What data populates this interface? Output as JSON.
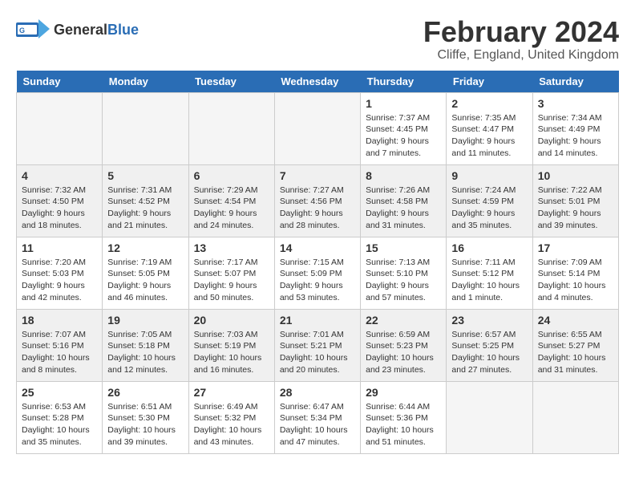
{
  "header": {
    "logo_general": "General",
    "logo_blue": "Blue",
    "title": "February 2024",
    "subtitle": "Cliffe, England, United Kingdom"
  },
  "weekdays": [
    "Sunday",
    "Monday",
    "Tuesday",
    "Wednesday",
    "Thursday",
    "Friday",
    "Saturday"
  ],
  "weeks": [
    [
      {
        "day": "",
        "info": ""
      },
      {
        "day": "",
        "info": ""
      },
      {
        "day": "",
        "info": ""
      },
      {
        "day": "",
        "info": ""
      },
      {
        "day": "1",
        "info": "Sunrise: 7:37 AM\nSunset: 4:45 PM\nDaylight: 9 hours\nand 7 minutes."
      },
      {
        "day": "2",
        "info": "Sunrise: 7:35 AM\nSunset: 4:47 PM\nDaylight: 9 hours\nand 11 minutes."
      },
      {
        "day": "3",
        "info": "Sunrise: 7:34 AM\nSunset: 4:49 PM\nDaylight: 9 hours\nand 14 minutes."
      }
    ],
    [
      {
        "day": "4",
        "info": "Sunrise: 7:32 AM\nSunset: 4:50 PM\nDaylight: 9 hours\nand 18 minutes."
      },
      {
        "day": "5",
        "info": "Sunrise: 7:31 AM\nSunset: 4:52 PM\nDaylight: 9 hours\nand 21 minutes."
      },
      {
        "day": "6",
        "info": "Sunrise: 7:29 AM\nSunset: 4:54 PM\nDaylight: 9 hours\nand 24 minutes."
      },
      {
        "day": "7",
        "info": "Sunrise: 7:27 AM\nSunset: 4:56 PM\nDaylight: 9 hours\nand 28 minutes."
      },
      {
        "day": "8",
        "info": "Sunrise: 7:26 AM\nSunset: 4:58 PM\nDaylight: 9 hours\nand 31 minutes."
      },
      {
        "day": "9",
        "info": "Sunrise: 7:24 AM\nSunset: 4:59 PM\nDaylight: 9 hours\nand 35 minutes."
      },
      {
        "day": "10",
        "info": "Sunrise: 7:22 AM\nSunset: 5:01 PM\nDaylight: 9 hours\nand 39 minutes."
      }
    ],
    [
      {
        "day": "11",
        "info": "Sunrise: 7:20 AM\nSunset: 5:03 PM\nDaylight: 9 hours\nand 42 minutes."
      },
      {
        "day": "12",
        "info": "Sunrise: 7:19 AM\nSunset: 5:05 PM\nDaylight: 9 hours\nand 46 minutes."
      },
      {
        "day": "13",
        "info": "Sunrise: 7:17 AM\nSunset: 5:07 PM\nDaylight: 9 hours\nand 50 minutes."
      },
      {
        "day": "14",
        "info": "Sunrise: 7:15 AM\nSunset: 5:09 PM\nDaylight: 9 hours\nand 53 minutes."
      },
      {
        "day": "15",
        "info": "Sunrise: 7:13 AM\nSunset: 5:10 PM\nDaylight: 9 hours\nand 57 minutes."
      },
      {
        "day": "16",
        "info": "Sunrise: 7:11 AM\nSunset: 5:12 PM\nDaylight: 10 hours\nand 1 minute."
      },
      {
        "day": "17",
        "info": "Sunrise: 7:09 AM\nSunset: 5:14 PM\nDaylight: 10 hours\nand 4 minutes."
      }
    ],
    [
      {
        "day": "18",
        "info": "Sunrise: 7:07 AM\nSunset: 5:16 PM\nDaylight: 10 hours\nand 8 minutes."
      },
      {
        "day": "19",
        "info": "Sunrise: 7:05 AM\nSunset: 5:18 PM\nDaylight: 10 hours\nand 12 minutes."
      },
      {
        "day": "20",
        "info": "Sunrise: 7:03 AM\nSunset: 5:19 PM\nDaylight: 10 hours\nand 16 minutes."
      },
      {
        "day": "21",
        "info": "Sunrise: 7:01 AM\nSunset: 5:21 PM\nDaylight: 10 hours\nand 20 minutes."
      },
      {
        "day": "22",
        "info": "Sunrise: 6:59 AM\nSunset: 5:23 PM\nDaylight: 10 hours\nand 23 minutes."
      },
      {
        "day": "23",
        "info": "Sunrise: 6:57 AM\nSunset: 5:25 PM\nDaylight: 10 hours\nand 27 minutes."
      },
      {
        "day": "24",
        "info": "Sunrise: 6:55 AM\nSunset: 5:27 PM\nDaylight: 10 hours\nand 31 minutes."
      }
    ],
    [
      {
        "day": "25",
        "info": "Sunrise: 6:53 AM\nSunset: 5:28 PM\nDaylight: 10 hours\nand 35 minutes."
      },
      {
        "day": "26",
        "info": "Sunrise: 6:51 AM\nSunset: 5:30 PM\nDaylight: 10 hours\nand 39 minutes."
      },
      {
        "day": "27",
        "info": "Sunrise: 6:49 AM\nSunset: 5:32 PM\nDaylight: 10 hours\nand 43 minutes."
      },
      {
        "day": "28",
        "info": "Sunrise: 6:47 AM\nSunset: 5:34 PM\nDaylight: 10 hours\nand 47 minutes."
      },
      {
        "day": "29",
        "info": "Sunrise: 6:44 AM\nSunset: 5:36 PM\nDaylight: 10 hours\nand 51 minutes."
      },
      {
        "day": "",
        "info": ""
      },
      {
        "day": "",
        "info": ""
      }
    ]
  ]
}
